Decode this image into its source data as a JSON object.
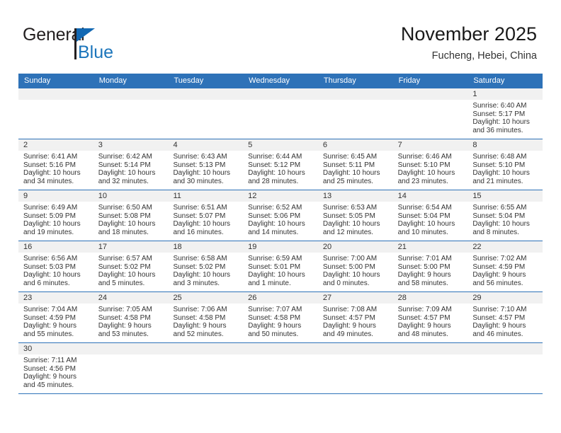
{
  "brand": {
    "name_top": "General",
    "name_bottom": "Blue",
    "accent_color": "#1b75bb",
    "flag_icon": "flag-triangle-icon"
  },
  "header": {
    "title": "November 2025",
    "location": "Fucheng, Hebei, China"
  },
  "calendar": {
    "header_bg": "#2e72b8",
    "date_strip_bg": "#f1f1f1",
    "weekday_headers": [
      "Sunday",
      "Monday",
      "Tuesday",
      "Wednesday",
      "Thursday",
      "Friday",
      "Saturday"
    ],
    "weeks": [
      [
        {
          "date": ""
        },
        {
          "date": ""
        },
        {
          "date": ""
        },
        {
          "date": ""
        },
        {
          "date": ""
        },
        {
          "date": ""
        },
        {
          "date": "1",
          "sunrise": "Sunrise: 6:40 AM",
          "sunset": "Sunset: 5:17 PM",
          "daylight_1": "Daylight: 10 hours",
          "daylight_2": "and 36 minutes."
        }
      ],
      [
        {
          "date": "2",
          "sunrise": "Sunrise: 6:41 AM",
          "sunset": "Sunset: 5:16 PM",
          "daylight_1": "Daylight: 10 hours",
          "daylight_2": "and 34 minutes."
        },
        {
          "date": "3",
          "sunrise": "Sunrise: 6:42 AM",
          "sunset": "Sunset: 5:14 PM",
          "daylight_1": "Daylight: 10 hours",
          "daylight_2": "and 32 minutes."
        },
        {
          "date": "4",
          "sunrise": "Sunrise: 6:43 AM",
          "sunset": "Sunset: 5:13 PM",
          "daylight_1": "Daylight: 10 hours",
          "daylight_2": "and 30 minutes."
        },
        {
          "date": "5",
          "sunrise": "Sunrise: 6:44 AM",
          "sunset": "Sunset: 5:12 PM",
          "daylight_1": "Daylight: 10 hours",
          "daylight_2": "and 28 minutes."
        },
        {
          "date": "6",
          "sunrise": "Sunrise: 6:45 AM",
          "sunset": "Sunset: 5:11 PM",
          "daylight_1": "Daylight: 10 hours",
          "daylight_2": "and 25 minutes."
        },
        {
          "date": "7",
          "sunrise": "Sunrise: 6:46 AM",
          "sunset": "Sunset: 5:10 PM",
          "daylight_1": "Daylight: 10 hours",
          "daylight_2": "and 23 minutes."
        },
        {
          "date": "8",
          "sunrise": "Sunrise: 6:48 AM",
          "sunset": "Sunset: 5:10 PM",
          "daylight_1": "Daylight: 10 hours",
          "daylight_2": "and 21 minutes."
        }
      ],
      [
        {
          "date": "9",
          "sunrise": "Sunrise: 6:49 AM",
          "sunset": "Sunset: 5:09 PM",
          "daylight_1": "Daylight: 10 hours",
          "daylight_2": "and 19 minutes."
        },
        {
          "date": "10",
          "sunrise": "Sunrise: 6:50 AM",
          "sunset": "Sunset: 5:08 PM",
          "daylight_1": "Daylight: 10 hours",
          "daylight_2": "and 18 minutes."
        },
        {
          "date": "11",
          "sunrise": "Sunrise: 6:51 AM",
          "sunset": "Sunset: 5:07 PM",
          "daylight_1": "Daylight: 10 hours",
          "daylight_2": "and 16 minutes."
        },
        {
          "date": "12",
          "sunrise": "Sunrise: 6:52 AM",
          "sunset": "Sunset: 5:06 PM",
          "daylight_1": "Daylight: 10 hours",
          "daylight_2": "and 14 minutes."
        },
        {
          "date": "13",
          "sunrise": "Sunrise: 6:53 AM",
          "sunset": "Sunset: 5:05 PM",
          "daylight_1": "Daylight: 10 hours",
          "daylight_2": "and 12 minutes."
        },
        {
          "date": "14",
          "sunrise": "Sunrise: 6:54 AM",
          "sunset": "Sunset: 5:04 PM",
          "daylight_1": "Daylight: 10 hours",
          "daylight_2": "and 10 minutes."
        },
        {
          "date": "15",
          "sunrise": "Sunrise: 6:55 AM",
          "sunset": "Sunset: 5:04 PM",
          "daylight_1": "Daylight: 10 hours",
          "daylight_2": "and 8 minutes."
        }
      ],
      [
        {
          "date": "16",
          "sunrise": "Sunrise: 6:56 AM",
          "sunset": "Sunset: 5:03 PM",
          "daylight_1": "Daylight: 10 hours",
          "daylight_2": "and 6 minutes."
        },
        {
          "date": "17",
          "sunrise": "Sunrise: 6:57 AM",
          "sunset": "Sunset: 5:02 PM",
          "daylight_1": "Daylight: 10 hours",
          "daylight_2": "and 5 minutes."
        },
        {
          "date": "18",
          "sunrise": "Sunrise: 6:58 AM",
          "sunset": "Sunset: 5:02 PM",
          "daylight_1": "Daylight: 10 hours",
          "daylight_2": "and 3 minutes."
        },
        {
          "date": "19",
          "sunrise": "Sunrise: 6:59 AM",
          "sunset": "Sunset: 5:01 PM",
          "daylight_1": "Daylight: 10 hours",
          "daylight_2": "and 1 minute."
        },
        {
          "date": "20",
          "sunrise": "Sunrise: 7:00 AM",
          "sunset": "Sunset: 5:00 PM",
          "daylight_1": "Daylight: 10 hours",
          "daylight_2": "and 0 minutes."
        },
        {
          "date": "21",
          "sunrise": "Sunrise: 7:01 AM",
          "sunset": "Sunset: 5:00 PM",
          "daylight_1": "Daylight: 9 hours",
          "daylight_2": "and 58 minutes."
        },
        {
          "date": "22",
          "sunrise": "Sunrise: 7:02 AM",
          "sunset": "Sunset: 4:59 PM",
          "daylight_1": "Daylight: 9 hours",
          "daylight_2": "and 56 minutes."
        }
      ],
      [
        {
          "date": "23",
          "sunrise": "Sunrise: 7:04 AM",
          "sunset": "Sunset: 4:59 PM",
          "daylight_1": "Daylight: 9 hours",
          "daylight_2": "and 55 minutes."
        },
        {
          "date": "24",
          "sunrise": "Sunrise: 7:05 AM",
          "sunset": "Sunset: 4:58 PM",
          "daylight_1": "Daylight: 9 hours",
          "daylight_2": "and 53 minutes."
        },
        {
          "date": "25",
          "sunrise": "Sunrise: 7:06 AM",
          "sunset": "Sunset: 4:58 PM",
          "daylight_1": "Daylight: 9 hours",
          "daylight_2": "and 52 minutes."
        },
        {
          "date": "26",
          "sunrise": "Sunrise: 7:07 AM",
          "sunset": "Sunset: 4:58 PM",
          "daylight_1": "Daylight: 9 hours",
          "daylight_2": "and 50 minutes."
        },
        {
          "date": "27",
          "sunrise": "Sunrise: 7:08 AM",
          "sunset": "Sunset: 4:57 PM",
          "daylight_1": "Daylight: 9 hours",
          "daylight_2": "and 49 minutes."
        },
        {
          "date": "28",
          "sunrise": "Sunrise: 7:09 AM",
          "sunset": "Sunset: 4:57 PM",
          "daylight_1": "Daylight: 9 hours",
          "daylight_2": "and 48 minutes."
        },
        {
          "date": "29",
          "sunrise": "Sunrise: 7:10 AM",
          "sunset": "Sunset: 4:57 PM",
          "daylight_1": "Daylight: 9 hours",
          "daylight_2": "and 46 minutes."
        }
      ],
      [
        {
          "date": "30",
          "sunrise": "Sunrise: 7:11 AM",
          "sunset": "Sunset: 4:56 PM",
          "daylight_1": "Daylight: 9 hours",
          "daylight_2": "and 45 minutes."
        },
        {
          "date": ""
        },
        {
          "date": ""
        },
        {
          "date": ""
        },
        {
          "date": ""
        },
        {
          "date": ""
        },
        {
          "date": ""
        }
      ]
    ]
  }
}
